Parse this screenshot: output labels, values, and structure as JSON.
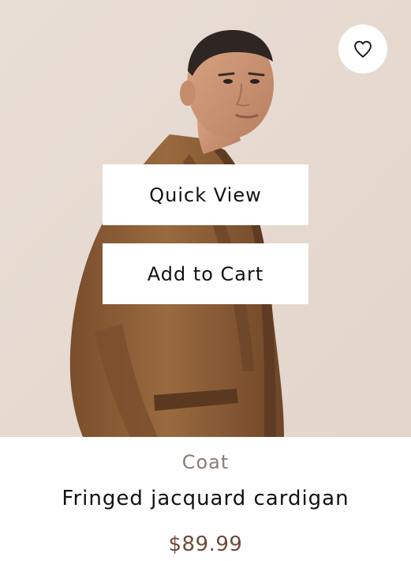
{
  "product": {
    "category": "Coat",
    "title": "Fringed jacquard cardigan",
    "price": "$89.99"
  },
  "actions": {
    "quick_view_label": "Quick View",
    "add_to_cart_label": "Add to Cart"
  },
  "wishlist": {
    "icon": "heart-outline-icon"
  },
  "colors": {
    "background": "#e8ddd4",
    "coat": "#8a5a33",
    "category_text": "#8a7d73",
    "price_text": "#6e4a3c"
  }
}
